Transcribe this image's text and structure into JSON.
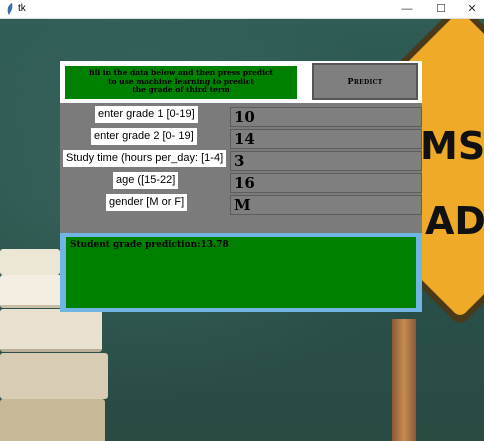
{
  "window": {
    "title": "tk",
    "minimize_glyph": "—",
    "maximize_glyph": "☐",
    "close_glyph": "✕"
  },
  "header": {
    "instruction_lines": [
      "fill in the data below and then press predict",
      "to use machine learning to predict",
      "the grade of third term"
    ],
    "predict_label": "Predict"
  },
  "form": {
    "fields": [
      {
        "label": "enter grade 1 [0-19]",
        "value": "10"
      },
      {
        "label": "enter grade 2 [0- 19]",
        "value": "14"
      },
      {
        "label": "Study time (hours per_day: [1-4]",
        "value": "3"
      },
      {
        "label": "age ([15-22]",
        "value": "16"
      },
      {
        "label": "gender [M or F]",
        "value": "M"
      }
    ]
  },
  "result": {
    "text": "Student grade prediction:13.78"
  },
  "background": {
    "sign_text_top": "MS",
    "sign_text_bottom": "AD"
  },
  "colors": {
    "instruction_bg": "#008000",
    "result_bg": "#008000",
    "result_border": "#71b6e3",
    "form_bg": "#7b7b7b",
    "button_bg": "#7f7f7f"
  }
}
